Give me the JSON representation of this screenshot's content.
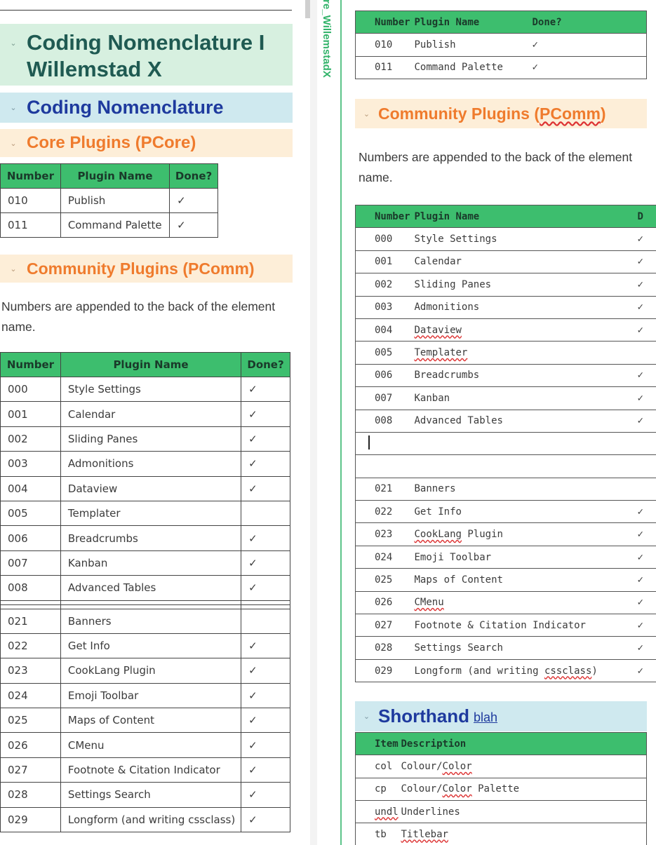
{
  "left": {
    "title_heading": "Coding Nomenclature I Willemstad X",
    "nomenclature_heading": "Coding Nomenclature",
    "core_heading": "Core Plugins (PCore)",
    "core_table": {
      "headers": [
        "Number",
        "Plugin Name",
        "Done?"
      ],
      "rows": [
        [
          "010",
          "Publish",
          "✓"
        ],
        [
          "011",
          "Command Palette",
          "✓"
        ]
      ]
    },
    "community_heading": "Community Plugins (PComm)",
    "community_note": "Numbers are appended to the back of the element name.",
    "community_table": {
      "headers": [
        "Number",
        "Plugin Name",
        "Done?"
      ],
      "rows": [
        [
          "000",
          "Style Settings",
          "✓"
        ],
        [
          "001",
          "Calendar",
          "✓"
        ],
        [
          "002",
          "Sliding Panes",
          "✓"
        ],
        [
          "003",
          "Admonitions",
          "✓"
        ],
        [
          "004",
          "Dataview",
          "✓"
        ],
        [
          "005",
          "Templater",
          ""
        ],
        [
          "006",
          "Breadcrumbs",
          "✓"
        ],
        [
          "007",
          "Kanban",
          "✓"
        ],
        [
          "008",
          "Advanced Tables",
          "✓"
        ],
        [
          "",
          "",
          ""
        ],
        [
          "",
          "",
          ""
        ],
        [
          "021",
          "Banners",
          ""
        ],
        [
          "022",
          "Get Info",
          "✓"
        ],
        [
          "023",
          "CookLang Plugin",
          "✓"
        ],
        [
          "024",
          "Emoji Toolbar",
          "✓"
        ],
        [
          "025",
          "Maps of Content",
          "✓"
        ],
        [
          "026",
          "CMenu",
          "✓"
        ],
        [
          "027",
          "Footnote & Citation Indicator",
          "✓"
        ],
        [
          "028",
          "Settings Search",
          "✓"
        ],
        [
          "029",
          "Longform (and writing cssclass)",
          "✓"
        ]
      ]
    }
  },
  "divider": {
    "vertical_title": "ure_WillemstadX"
  },
  "right": {
    "core_table": {
      "headers": [
        "Number",
        "Plugin Name",
        "Done?"
      ],
      "rows": [
        [
          "010",
          "Publish",
          "✓"
        ],
        [
          "011",
          "Command Palette",
          "✓"
        ]
      ]
    },
    "community_heading_prefix": "Community Plugins (",
    "community_heading_link": "PComm",
    "community_heading_suffix": ")",
    "community_note": "Numbers are appended to the back of the element name.",
    "community_table": {
      "headers": [
        "Number",
        "Plugin Name",
        "D"
      ],
      "rows": [
        [
          "000",
          "Style Settings",
          "✓"
        ],
        [
          "001",
          "Calendar",
          "✓"
        ],
        [
          "002",
          "Sliding Panes",
          "✓"
        ],
        [
          "003",
          "Admonitions",
          "✓"
        ],
        [
          "004",
          "Dataview",
          "✓"
        ],
        [
          "005",
          "Templater",
          ""
        ],
        [
          "006",
          "Breadcrumbs",
          "✓"
        ],
        [
          "007",
          "Kanban",
          "✓"
        ],
        [
          "008",
          "Advanced Tables",
          "✓"
        ],
        [
          "",
          "",
          ""
        ],
        [
          "",
          "",
          ""
        ],
        [
          "021",
          "Banners",
          ""
        ],
        [
          "022",
          "Get Info",
          "✓"
        ],
        [
          "023",
          "CookLang Plugin",
          "✓"
        ],
        [
          "024",
          "Emoji Toolbar",
          "✓"
        ],
        [
          "025",
          "Maps of Content",
          "✓"
        ],
        [
          "026",
          "CMenu",
          "✓"
        ],
        [
          "027",
          "Footnote & Citation Indicator",
          "✓"
        ],
        [
          "028",
          "Settings Search",
          "✓"
        ],
        [
          "029",
          "Longform (and writing cssclass)",
          "✓"
        ]
      ]
    },
    "shorthand_heading": "Shorthand",
    "shorthand_link": "blah",
    "shorthand_table": {
      "headers": [
        "Item",
        "Description"
      ],
      "rows": [
        [
          "col",
          "Colour/Color"
        ],
        [
          "cp",
          "Colour/Color Palette"
        ],
        [
          "undl",
          "Underlines"
        ],
        [
          "tb",
          "Titlebar"
        ]
      ]
    }
  },
  "colors": {
    "table_header": "#3dbe6e",
    "title_bg": "#d7f0e0",
    "nomenclature_bg": "#cfe9ef",
    "plugins_bg": "#fdeed8",
    "orange_text": "#ef7b2d",
    "blue_text": "#1e3a9e",
    "accent_green": "#5cc48a"
  }
}
